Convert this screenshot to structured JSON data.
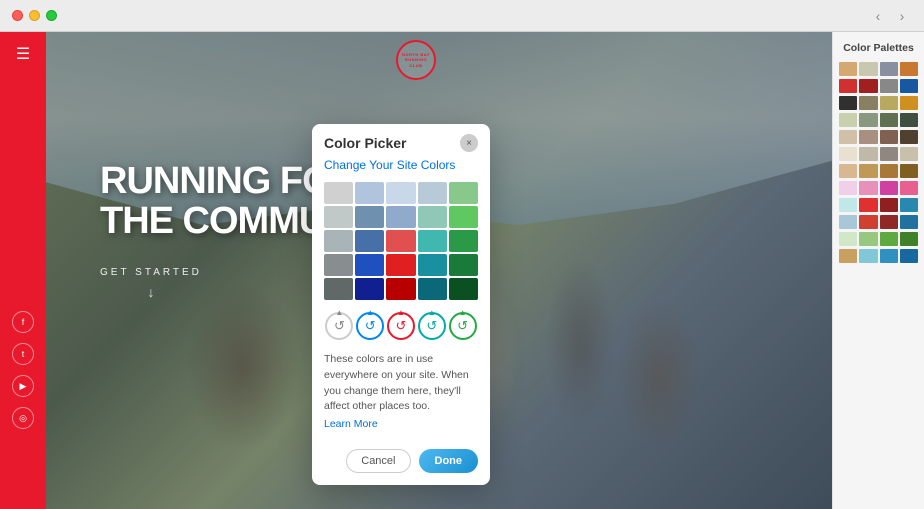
{
  "browser": {
    "back_label": "‹",
    "forward_label": "›"
  },
  "site": {
    "sidebar_icon": "☰",
    "logo_line1": "NORTH BAY",
    "logo_line2": "RUNNING CLUB",
    "hero_line1": "RUNNING FOR",
    "hero_line2": "THE COMMUNITY",
    "cta_label": "GET STARTED",
    "social": [
      "f",
      "t",
      "▶"
    ]
  },
  "color_picker": {
    "title": "Color Picker",
    "subtitle": "Change Your Site Colors",
    "close_label": "×",
    "description": "These colors are in use everywhere on your site. When you change them here, they'll affect other places too.",
    "learn_more_label": "Learn More",
    "cancel_label": "Cancel",
    "done_label": "Done",
    "color_grid": [
      [
        "#d0d0d0",
        "#b0c4de",
        "#c8d8e8",
        "#b8cad8",
        "#88c88a"
      ],
      [
        "#c0c8c8",
        "#7090b0",
        "#90aacc",
        "#90c8b8",
        "#60c860"
      ],
      [
        "#a8b4b8",
        "#4870a8",
        "#e05050",
        "#40b8b0",
        "#2a9a48"
      ],
      [
        "#888e90",
        "#2050c0",
        "#e02020",
        "#1890a0",
        "#1a7a38"
      ],
      [
        "#606868",
        "#102090",
        "#b80000",
        "#0a6878",
        "#0a5020"
      ]
    ],
    "action_buttons": [
      {
        "color": "gray",
        "icon": "↺",
        "type": "neutral"
      },
      {
        "color": "blue",
        "icon": "↺",
        "type": "blue"
      },
      {
        "color": "red",
        "icon": "↺",
        "type": "red"
      },
      {
        "color": "teal",
        "icon": "↺",
        "type": "teal"
      },
      {
        "color": "green",
        "icon": "↺",
        "type": "green"
      }
    ]
  },
  "palettes": {
    "title": "Color Palettes",
    "rows": [
      [
        "#d4a870",
        "#c8c8b0",
        "#8890a0",
        "#c87830"
      ],
      [
        "#d03030",
        "#a02020",
        "#888888",
        "#1858a0"
      ],
      [
        "#303030",
        "#888060",
        "#b8a860",
        "#d09020"
      ],
      [
        "#c8d0b0",
        "#8a9880",
        "#607050",
        "#405040"
      ],
      [
        "#d0c0a8",
        "#a89080",
        "#806050",
        "#504030"
      ],
      [
        "#e8e0d0",
        "#c0b8a8",
        "#908880",
        "#c8c0a8"
      ],
      [
        "#d8b890",
        "#c09858",
        "#a87838",
        "#806020"
      ],
      [
        "#f0d0e8",
        "#e890b8",
        "#d040a0",
        "#e86090"
      ],
      [
        "#c0e8e8",
        "#e03030",
        "#902020",
        "#2888b0"
      ],
      [
        "#a8c8d8",
        "#d04030",
        "#902828",
        "#2070a0"
      ],
      [
        "#d0e8c8",
        "#98c880",
        "#60a840",
        "#408028"
      ],
      [
        "#c8a060",
        "#80c8d8",
        "#3090c0",
        "#1868a0"
      ]
    ]
  }
}
